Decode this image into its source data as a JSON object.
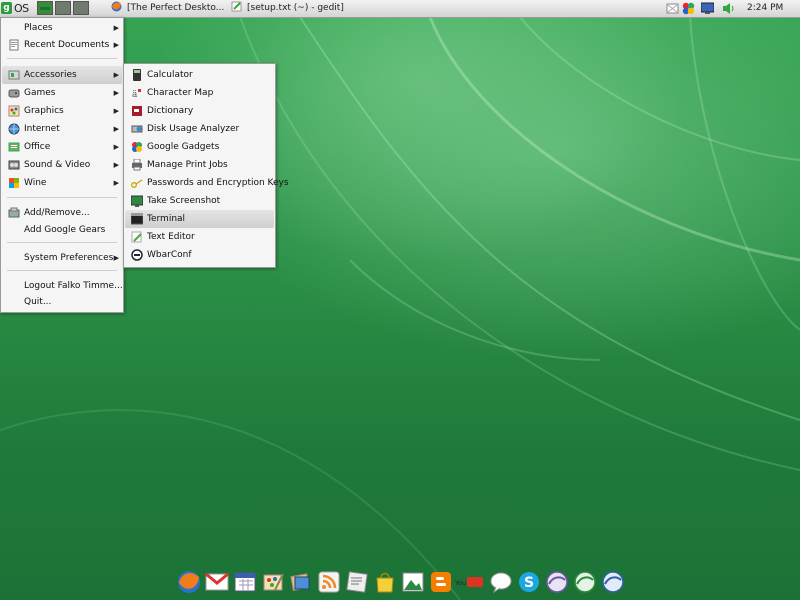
{
  "top_panel": {
    "os_label": "OS",
    "tasks": [
      {
        "label": "[The Perfect Deskto...",
        "icon": "firefox-icon"
      },
      {
        "label": "[setup.txt (~) - gedit]",
        "icon": "gedit-icon"
      }
    ],
    "clock": "2:24 PM"
  },
  "main_menu": {
    "items": [
      {
        "label": "Places",
        "icon": "",
        "submenu": true
      },
      {
        "label": "Recent Documents",
        "icon": "recent-documents-icon",
        "submenu": true
      },
      {
        "label": "Accessories",
        "icon": "accessories-icon",
        "submenu": true,
        "highlighted": true
      },
      {
        "label": "Games",
        "icon": "games-icon",
        "submenu": true
      },
      {
        "label": "Graphics",
        "icon": "graphics-icon",
        "submenu": true
      },
      {
        "label": "Internet",
        "icon": "internet-icon",
        "submenu": true
      },
      {
        "label": "Office",
        "icon": "office-icon",
        "submenu": true
      },
      {
        "label": "Sound & Video",
        "icon": "sound-video-icon",
        "submenu": true
      },
      {
        "label": "Wine",
        "icon": "wine-icon",
        "submenu": true
      },
      {
        "label": "Add/Remove...",
        "icon": "add-remove-icon",
        "submenu": false
      },
      {
        "label": "Add Google Gears",
        "icon": "",
        "submenu": false
      },
      {
        "label": "System Preferences",
        "icon": "",
        "submenu": true
      },
      {
        "label": "Logout Falko Timme...",
        "icon": "",
        "submenu": false
      },
      {
        "label": "Quit...",
        "icon": "",
        "submenu": false
      }
    ]
  },
  "accessories_menu": {
    "items": [
      {
        "label": "Calculator",
        "icon": "calculator-icon"
      },
      {
        "label": "Character Map",
        "icon": "character-map-icon"
      },
      {
        "label": "Dictionary",
        "icon": "dictionary-icon"
      },
      {
        "label": "Disk Usage Analyzer",
        "icon": "disk-usage-icon"
      },
      {
        "label": "Google Gadgets",
        "icon": "google-gadgets-icon"
      },
      {
        "label": "Manage Print Jobs",
        "icon": "printer-icon"
      },
      {
        "label": "Passwords and Encryption Keys",
        "icon": "keys-icon"
      },
      {
        "label": "Take Screenshot",
        "icon": "screenshot-icon"
      },
      {
        "label": "Terminal",
        "icon": "terminal-icon",
        "highlighted": true
      },
      {
        "label": "Text Editor",
        "icon": "text-editor-icon"
      },
      {
        "label": "WbarConf",
        "icon": "wbarconf-icon"
      }
    ]
  },
  "dock": {
    "icons": [
      "firefox-icon",
      "gmail-icon",
      "calendar-icon",
      "paint-icon",
      "gallery-icon",
      "rss-icon",
      "news-icon",
      "shopping-bag-icon",
      "photos-icon",
      "blogger-icon",
      "youtube-icon",
      "chat-icon",
      "skype-icon",
      "openoffice-writer-icon",
      "openoffice-calc-icon",
      "openoffice-impress-icon"
    ],
    "youtube_text": "YouTube"
  }
}
